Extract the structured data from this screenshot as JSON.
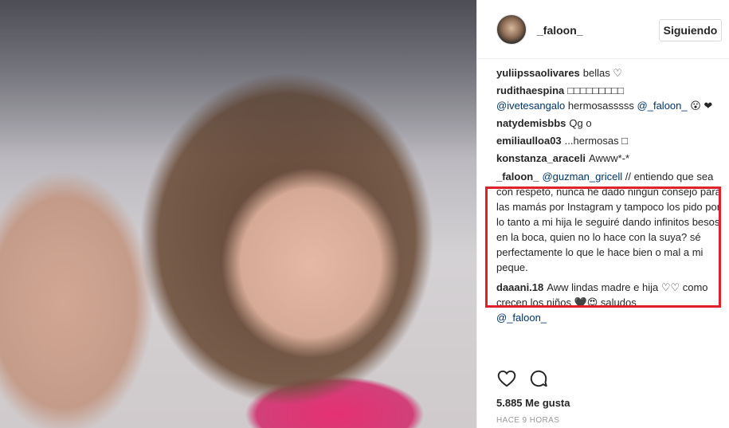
{
  "post": {
    "username": "_faloon_",
    "follow_label": "Siguiendo",
    "likes_text": "5.885 Me gusta",
    "time_text": "HACE 9 HORAS"
  },
  "comments": [
    {
      "user": "yuliipssaolivares",
      "text": "bellas ♡"
    },
    {
      "user": "rudithaespina",
      "text": "□□□□□□□□□",
      "mention1": "@ivetesangalo",
      "text2": "hermosasssss",
      "mention2": "@_faloon_",
      "text3": "😮 ❤"
    },
    {
      "user": "natydemisbbs",
      "text": "Qg o"
    },
    {
      "user": "emiliaulloa03",
      "text": "...hermosas □"
    },
    {
      "user": "konstanza_araceli",
      "text": "Awww*-*"
    },
    {
      "user": "_faloon_",
      "mention1": "@guzman_gricell",
      "text": "// entiendo que sea con respeto, nunca he dado ningún consejo para las mamás por Instagram y tampoco los pido por lo tanto a mi hija le seguiré dando infinitos besos en la boca, quien no lo hace con la suya? sé perfectamente lo que le hace bien o mal a mi peque."
    },
    {
      "user": "daaani.18",
      "text": "Aww lindas madre e hija ♡♡ como crecen los niños 🖤😍 saludos",
      "mention1": "@_faloon_"
    }
  ],
  "icons": {
    "like": "heart-icon",
    "comment": "comment-bubble-icon"
  },
  "colors": {
    "highlight_border": "#e0202a",
    "mention": "#003569",
    "text": "#262626",
    "muted": "#999999"
  }
}
